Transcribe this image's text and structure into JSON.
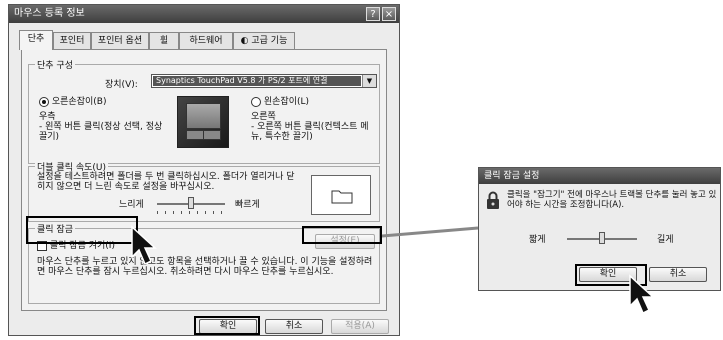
{
  "main_dialog": {
    "title": "마우스 등록 정보",
    "help_btn": "?",
    "close_btn": "×",
    "tabs": [
      {
        "label": "단추"
      },
      {
        "label": "포인터"
      },
      {
        "label": "포인터 옵션"
      },
      {
        "label": "휠"
      },
      {
        "label": "하드웨어"
      },
      {
        "label": "고급 기능"
      }
    ],
    "button_config": {
      "title": "단추 구성",
      "device_label": "장치(V):",
      "device_value": "Synaptics TouchPad V5.8 가 PS/2 포트에 연결",
      "right_hand_label": "오른손잡이(B)",
      "left_hand_label": "왼손잡이(L)",
      "left_desc_title": "우측",
      "left_desc": "- 왼쪽 버튼 클릭(정상 선택, 정상 끌기)",
      "right_desc_title": "오른쪽",
      "right_desc": "- 오른쪽 버튼 클릭(컨텍스트 메뉴, 특수한 끌기)"
    },
    "double_click": {
      "title": "더블 클릭 속도(U)",
      "desc": "설정을 테스트하려면 폴더를 두 번 클릭하십시오. 폴더가 열리거나 닫히지 않으면 더 느린 속도로 설정을 바꾸십시오.",
      "slow_label": "느리게",
      "fast_label": "빠르게",
      "speed_level": 0.5
    },
    "click_lock": {
      "title": "클릭 잠금",
      "checkbox_label": "클릭 잠금 켜기(I)",
      "checked": false,
      "settings_btn": "설정(E)",
      "desc": "마우스 단추를 누르고 있지 않고도 항목을 선택하거나 끌 수 있습니다. 이 기능을 설정하려면 마우스 단추를 잠시 누르십시오. 취소하려면 다시 마우스 단추를 누르십시오."
    },
    "footer": {
      "ok": "확인",
      "cancel": "취소",
      "apply": "적용(A)"
    }
  },
  "lock_dialog": {
    "title": "클릭 잠금 설정",
    "desc": "클릭을 \"잠그기\" 전에 마우스나 트랙볼 단추를 눌러 놓고 있어야 하는 시간을 조정합니다(A).",
    "short_label": "짧게",
    "long_label": "길게",
    "duration_level": 0.5,
    "ok": "확인",
    "cancel": "취소"
  }
}
